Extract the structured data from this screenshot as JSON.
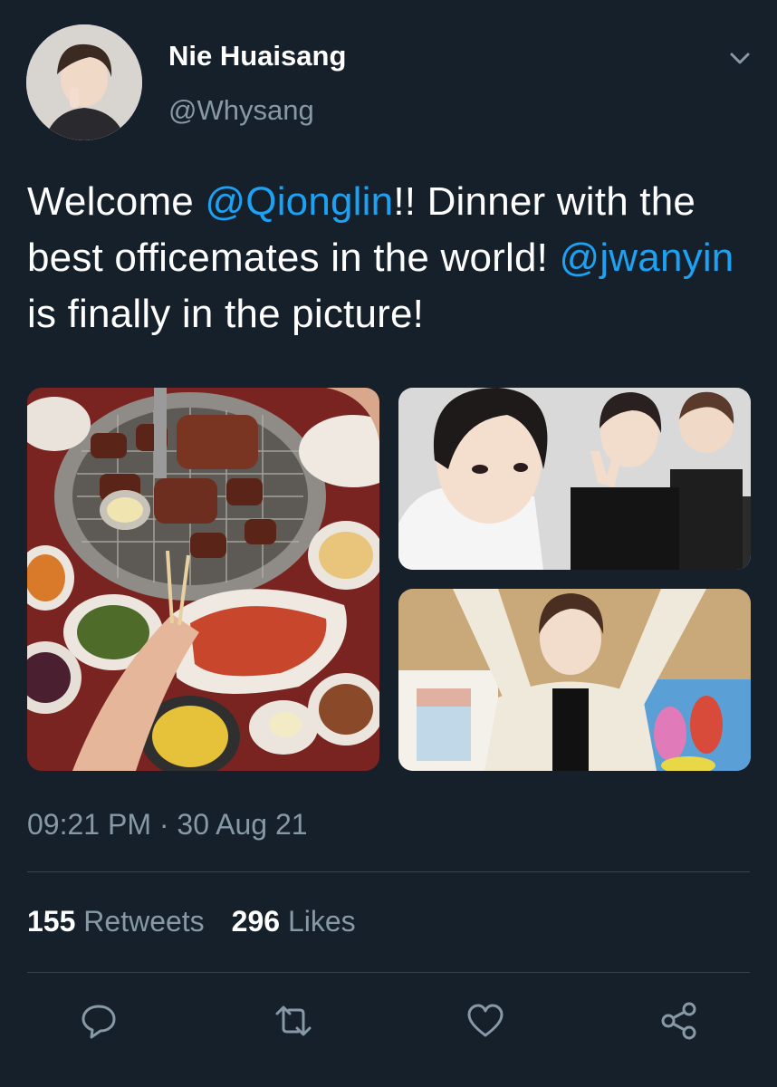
{
  "user": {
    "display_name": "Nie Huaisang",
    "handle": "@Whysang"
  },
  "tweet": {
    "text_part1": "Welcome ",
    "mention1": "@Qionglin",
    "text_part2": "!! Dinner with the best officemates in the world! ",
    "mention2": "@jwanyin",
    "text_part3": " is finally in the picture!",
    "timestamp": "09:21 PM · 30 Aug 21"
  },
  "stats": {
    "retweets_count": "155",
    "retweets_label": "Retweets",
    "likes_count": "296",
    "likes_label": "Likes"
  },
  "icons": {
    "menu": "chevron-down-icon",
    "reply": "reply-icon",
    "retweet": "retweet-icon",
    "like": "heart-icon",
    "share": "share-icon"
  },
  "colors": {
    "background": "#15202b",
    "link": "#1da1f2",
    "secondary_text": "#8899a6",
    "divider": "#38444d"
  }
}
